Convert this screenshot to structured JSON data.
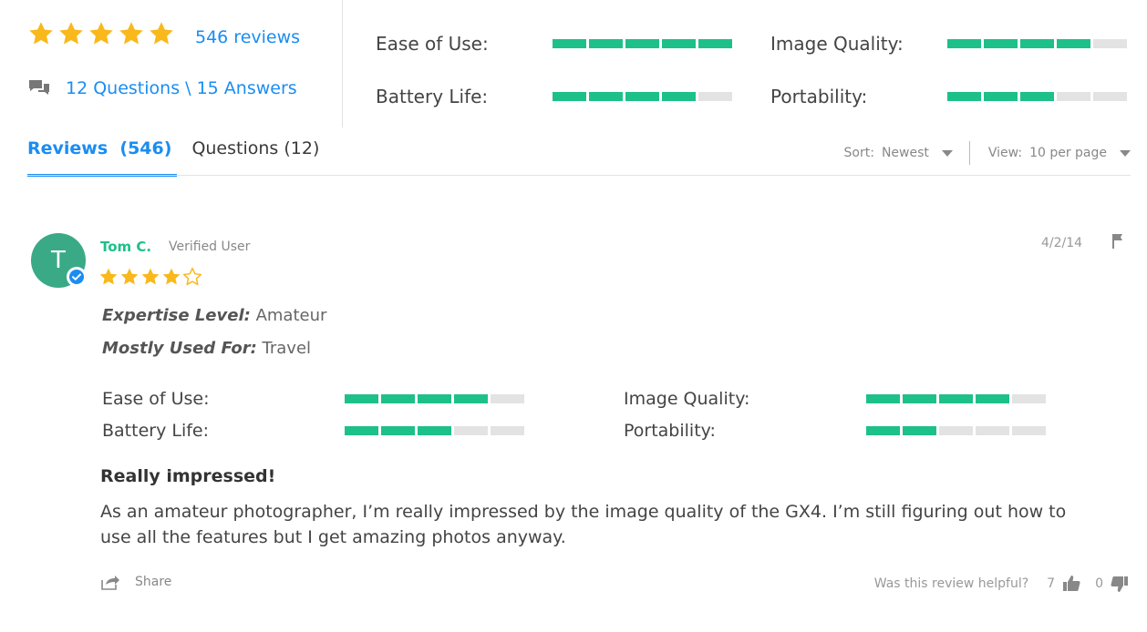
{
  "summary": {
    "overall_rating": 5,
    "reviews_link": "546 reviews",
    "qa_link": "12 Questions \\ 15 Answers",
    "ratings": [
      {
        "label": "Ease of Use:",
        "value": 5
      },
      {
        "label": "Image Quality:",
        "value": 4
      },
      {
        "label": "Battery Life:",
        "value": 4
      },
      {
        "label": "Portability:",
        "value": 3
      }
    ]
  },
  "tabs": {
    "reviews": "Reviews",
    "reviews_count": "(546)",
    "questions": "Questions (12)"
  },
  "controls": {
    "sort_label": "Sort:",
    "sort_value": "Newest",
    "view_label": "View:",
    "view_value": "10 per page"
  },
  "review": {
    "avatar_initial": "T",
    "author": "Tom C.",
    "verified": "Verified User",
    "rating": 4,
    "date": "4/2/14",
    "expertise_key": "Expertise Level:",
    "expertise_value": "Amateur",
    "used_for_key": "Mostly Used For:",
    "used_for_value": "Travel",
    "ratings": [
      {
        "label": "Ease of Use:",
        "value": 4
      },
      {
        "label": "Image Quality:",
        "value": 4
      },
      {
        "label": "Battery Life:",
        "value": 3
      },
      {
        "label": "Portability:",
        "value": 2
      }
    ],
    "title": "Really impressed!",
    "body": "As an amateur photographer, I’m really impressed by the image quality of the GX4. I’m still figuring out how to use all the features but I get amazing photos anyway.",
    "share_label": "Share",
    "helpful_question": "Was this review helpful?",
    "helpful_yes": "7",
    "helpful_no": "0"
  },
  "colors": {
    "accent_blue": "#1a8df2",
    "rating_green": "#1ec08a",
    "star_gold": "#f9b81b",
    "avatar_green": "#3aaa86",
    "bar_empty": "#e3e3e3"
  },
  "icons": {
    "star": "star-icon",
    "questions": "speech-bubbles-icon",
    "verified": "checkmark-badge-icon",
    "flag": "flag-icon",
    "share": "share-icon",
    "thumbs_up": "thumbs-up-icon",
    "thumbs_down": "thumbs-down-icon"
  }
}
